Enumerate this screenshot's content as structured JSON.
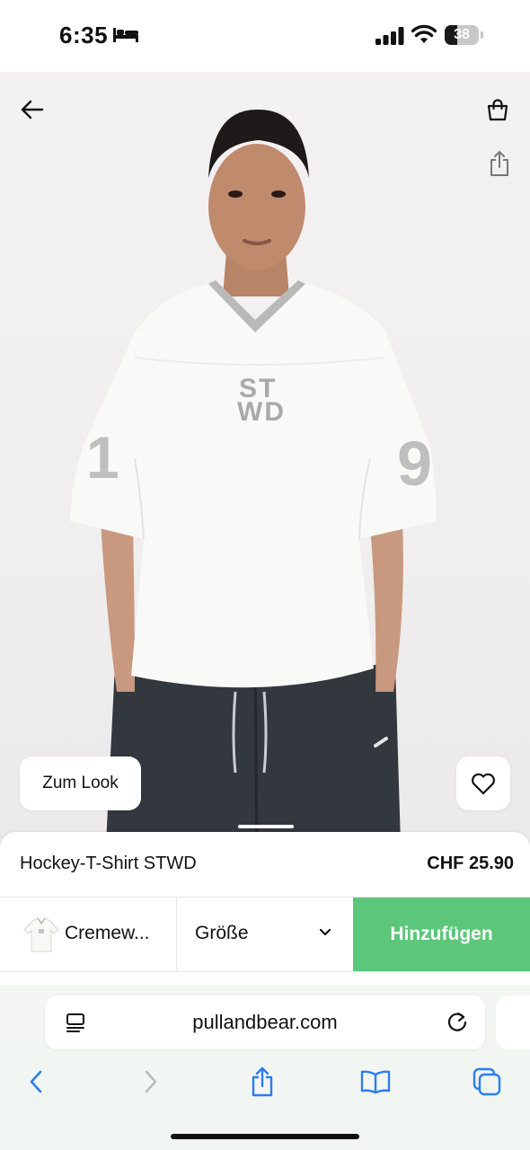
{
  "status_bar": {
    "time": "6:35",
    "battery_level": "38",
    "battery_fraction": 0.38
  },
  "hero": {
    "image_alt": "Model wearing white hockey t-shirt with STWD logo and dark joggers",
    "shirt_logo_line1": "ST",
    "shirt_logo_line2": "WD",
    "sleeve_number_left": "1",
    "sleeve_number_right": "9",
    "look_button": "Zum Look",
    "carousel_count": 7,
    "carousel_active_index": 0
  },
  "product": {
    "name": "Hockey-T-Shirt STWD",
    "price": "CHF 25.90",
    "color_label": "Cremew...",
    "size_label": "Größe",
    "add_button": "Hinzufügen",
    "accent_color": "#5cc77a"
  },
  "browser": {
    "url": "pullandbear.com"
  },
  "icons": {
    "back": "arrow-left-icon",
    "bag": "shopping-bag-icon",
    "share": "share-icon",
    "favorite": "heart-icon",
    "reader": "reader-list-icon",
    "reload": "reload-icon",
    "nav_back": "chevron-left-icon",
    "nav_forward": "chevron-right-icon",
    "browser_share": "share-icon",
    "bookmarks": "book-icon",
    "tabs": "tabs-icon"
  }
}
